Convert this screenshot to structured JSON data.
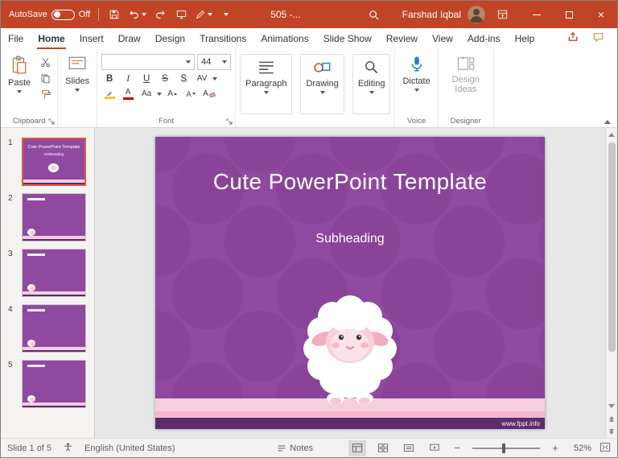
{
  "titlebar": {
    "autosave_label": "AutoSave",
    "autosave_state": "Off",
    "document_title": "505 -...",
    "user_name": "Farshad Iqbal"
  },
  "menubar": {
    "tabs": [
      "File",
      "Home",
      "Insert",
      "Draw",
      "Design",
      "Transitions",
      "Animations",
      "Slide Show",
      "Review",
      "View",
      "Add-ins",
      "Help"
    ],
    "active_tab": "Home"
  },
  "ribbon": {
    "paste_label": "Paste",
    "slides_label": "Slides",
    "font_name": "",
    "font_size": "44",
    "bold": "B",
    "italic": "I",
    "underline": "U",
    "strike": "S",
    "shadow": "S",
    "spacing": "AV",
    "font_color": "A",
    "change_case": "Aa",
    "size_up": "A",
    "size_down": "A",
    "clear_format": "A",
    "paragraph_label": "Paragraph",
    "drawing_label": "Drawing",
    "editing_label": "Editing",
    "dictate_label": "Dictate",
    "design_ideas_label": "Design Ideas",
    "group_labels": {
      "clipboard": "Clipboard",
      "font": "Font",
      "voice": "Voice",
      "designer": "Designer"
    }
  },
  "slide_panel": {
    "slides": [
      {
        "number": "1"
      },
      {
        "number": "2"
      },
      {
        "number": "3"
      },
      {
        "number": "4"
      },
      {
        "number": "5"
      }
    ]
  },
  "slide": {
    "title": "Cute PowerPoint Template",
    "subtitle": "Subheading",
    "footer_link": "www.fppt.info"
  },
  "statusbar": {
    "slide_indicator": "Slide 1 of 5",
    "language": "English (United States)",
    "notes_label": "Notes",
    "zoom_level": "52%"
  },
  "colors": {
    "titlebar": "#C04425",
    "accent": "#C04425",
    "slide_purple": "#9049A1",
    "selection": "#E25A33",
    "dictate_blue": "#2B7CD3",
    "stripe_pink": "#F7CEDD",
    "footer_purple": "#5E2B6E"
  }
}
